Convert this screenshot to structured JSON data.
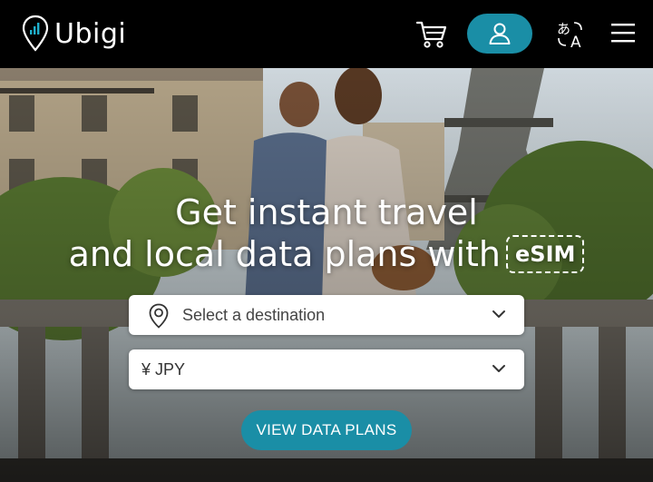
{
  "nav": {
    "brand": "Ubigi",
    "icons": {
      "logo": "location-pin-signal-icon",
      "cart": "cart-icon",
      "account": "user-icon",
      "language": "translate-icon",
      "menu": "hamburger-menu-icon"
    }
  },
  "hero": {
    "title_line1": "Get instant travel",
    "title_line2": "and local data plans with",
    "badge": "eSIM",
    "destination": {
      "placeholder": "Select a destination",
      "icon": "location-pin-icon"
    },
    "currency": {
      "value": "¥ JPY"
    },
    "cta_label": "VIEW DATA PLANS"
  },
  "colors": {
    "accent": "#1a8ea6",
    "nav_bg": "#000000"
  }
}
